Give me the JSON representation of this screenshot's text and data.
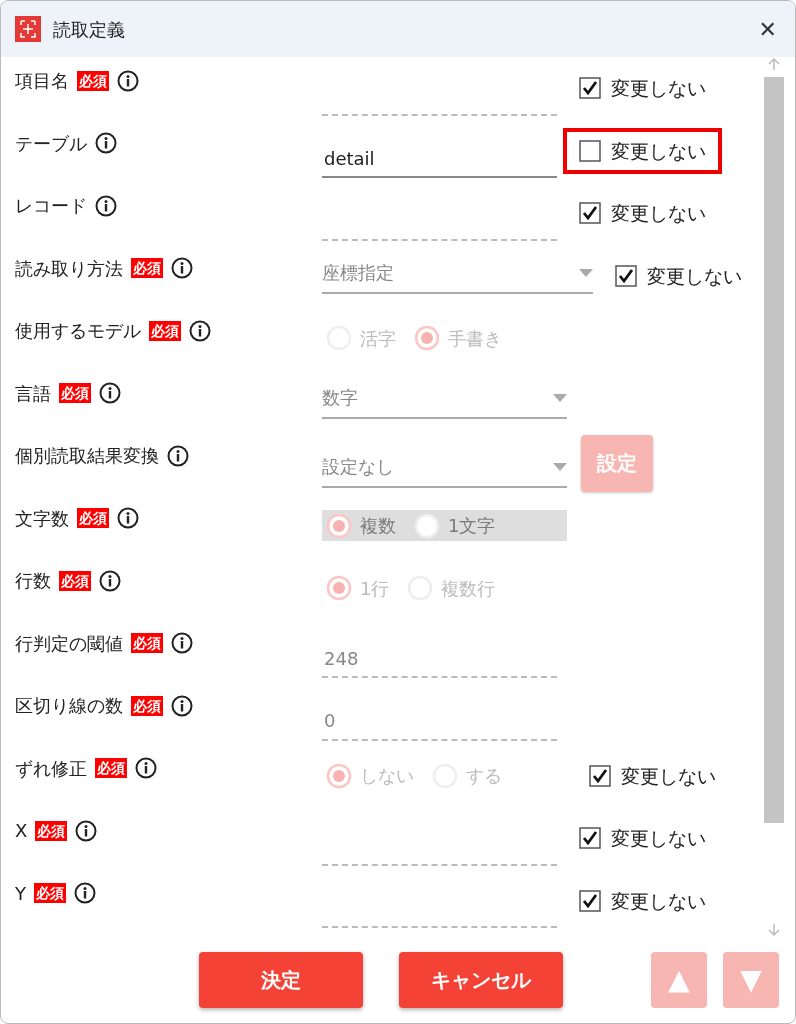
{
  "window": {
    "title": "読取定義",
    "close": "✕"
  },
  "rows": [
    {
      "label": "項目名",
      "badge": "必須",
      "field": {
        "kind": "text",
        "disabled": true
      },
      "no_change": {
        "label": "変更しない",
        "checked": true,
        "highlighted": false
      }
    },
    {
      "label": "テーブル",
      "field": {
        "kind": "text",
        "value": "detail",
        "disabled": false
      },
      "no_change": {
        "label": "変更しない",
        "checked": false,
        "highlighted": true
      }
    },
    {
      "label": "レコード",
      "field": {
        "kind": "text",
        "disabled": true
      },
      "no_change": {
        "label": "変更しない",
        "checked": true,
        "highlighted": false
      }
    },
    {
      "label": "読み取り方法",
      "badge": "必須",
      "field": {
        "kind": "select",
        "value": "座標指定",
        "wide": true
      },
      "no_change": {
        "label": "変更しない",
        "checked": true,
        "highlighted": false
      }
    },
    {
      "label": "使用するモデル",
      "badge": "必須",
      "field": {
        "kind": "radio",
        "highlighted": false,
        "options": [
          {
            "label": "活字",
            "selected": false
          },
          {
            "label": "手書き",
            "selected": true
          }
        ]
      }
    },
    {
      "label": "言語",
      "badge": "必須",
      "field": {
        "kind": "select",
        "value": "数字",
        "wide": false
      }
    },
    {
      "label": "個別読取結果変換",
      "field": {
        "kind": "select",
        "value": "設定なし",
        "wide": false,
        "button": "設定"
      }
    },
    {
      "label": "文字数",
      "badge": "必須",
      "field": {
        "kind": "radio",
        "highlighted": true,
        "options": [
          {
            "label": "複数",
            "selected": true
          },
          {
            "label": "1文字",
            "selected": false
          }
        ]
      }
    },
    {
      "label": "行数",
      "badge": "必須",
      "field": {
        "kind": "radio",
        "highlighted": false,
        "options": [
          {
            "label": "1行",
            "selected": true
          },
          {
            "label": "複数行",
            "selected": false
          }
        ]
      }
    },
    {
      "label": "行判定の閾値",
      "badge": "必須",
      "field": {
        "kind": "text",
        "value": "248",
        "disabled": true
      }
    },
    {
      "label": "区切り線の数",
      "badge": "必須",
      "field": {
        "kind": "text",
        "value": "0",
        "disabled": true
      }
    },
    {
      "label": "ずれ修正",
      "badge": "必須",
      "field": {
        "kind": "radio",
        "highlighted": false,
        "options": [
          {
            "label": "しない",
            "selected": true
          },
          {
            "label": "する",
            "selected": false
          }
        ]
      },
      "no_change": {
        "label": "変更しない",
        "checked": true,
        "highlighted": false
      }
    },
    {
      "label": "X",
      "badge": "必須",
      "field": {
        "kind": "text",
        "disabled": true
      },
      "no_change": {
        "label": "変更しない",
        "checked": true,
        "highlighted": false
      }
    },
    {
      "label": "Y",
      "badge": "必須",
      "field": {
        "kind": "text",
        "disabled": true
      },
      "no_change": {
        "label": "変更しない",
        "checked": true,
        "highlighted": false
      }
    }
  ],
  "footer": {
    "buttons": [
      "決定",
      "キャンセル"
    ],
    "nav": [
      "▲",
      "▼"
    ]
  }
}
